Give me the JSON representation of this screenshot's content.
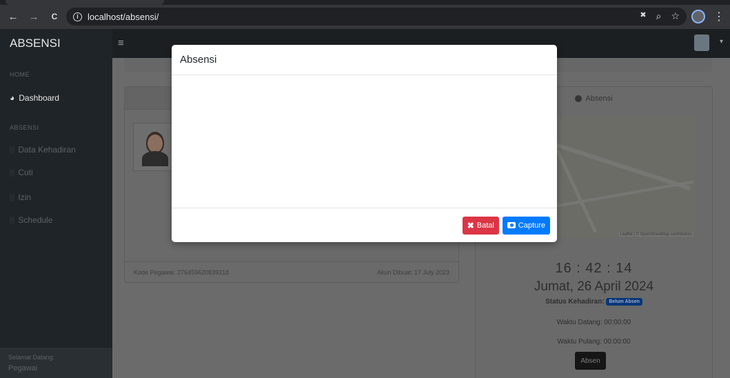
{
  "browser": {
    "url": "localhost/absensi/",
    "back_icon": "←",
    "forward_icon": "→",
    "reload_icon": "C",
    "info_icon": "i",
    "eye_slash_icon": "✖",
    "zoom_icon": "⌕",
    "star_icon": "☆",
    "menu_icon": "⋮"
  },
  "navbar": {
    "brand": "ABSENSI",
    "hamburger_icon": "≡",
    "caret_icon": "▾"
  },
  "sidebar": {
    "heading_home": "HOME",
    "dashboard_icon": "◕",
    "dashboard_label": "Dashboard",
    "heading_absensi": "ABSENSI",
    "items": [
      {
        "icon": "░",
        "label": "Data Kehadiran"
      },
      {
        "icon": "░",
        "label": "Cuti"
      },
      {
        "icon": "░",
        "label": "Izin"
      },
      {
        "icon": "░",
        "label": "Schedule"
      }
    ],
    "footer_line1": "Selamat Datang:",
    "footer_line2": "Pegawai"
  },
  "profile_card": {
    "kode_pegawai": "Kode Pegawai: 276459620839318",
    "akun_dibuat": "Akun Dibuat: 17 July 2023"
  },
  "absensi_card": {
    "title": "Absensi",
    "map_attribution": "Leaflet | © OpenStreetMap contributors",
    "time": "16 : 42 : 14",
    "date": "Jumat, 26 April 2024",
    "status_label": "Status Kehadiran:",
    "status_badge": "Belum Absen",
    "waktu_datang": "Waktu Datang: 00:00:00",
    "waktu_pulang": "Waktu Pulang: 00:00:00",
    "absen_button": "Absen"
  },
  "modal": {
    "title": "Absensi",
    "batal_icon": "✖",
    "batal_label": "Batal",
    "capture_label": "Capture"
  }
}
